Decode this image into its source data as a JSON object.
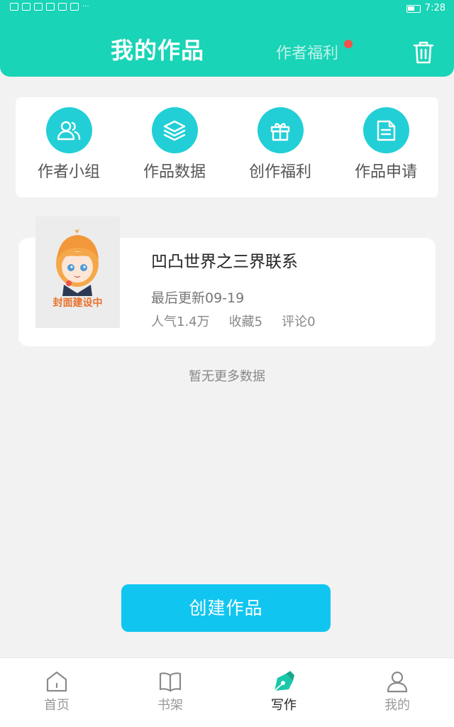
{
  "status_bar": {
    "time": "7:28",
    "overflow": "···"
  },
  "header": {
    "title": "我的作品",
    "welfare_link": "作者福利",
    "trash_icon": "trash-icon"
  },
  "quick_actions": [
    {
      "label": "作者小组",
      "icon": "group-icon"
    },
    {
      "label": "作品数据",
      "icon": "layers-icon"
    },
    {
      "label": "创作福利",
      "icon": "gift-icon"
    },
    {
      "label": "作品申请",
      "icon": "document-icon"
    }
  ],
  "work": {
    "cover_text": "封面建设中",
    "title": "凹凸世界之三界联系",
    "updated": "最后更新09-19",
    "popularity": "人气1.4万",
    "favorites": "收藏5",
    "comments": "评论0"
  },
  "list_footer": "暂无更多数据",
  "create_button": "创建作品",
  "bottom_nav": [
    {
      "label": "首页",
      "icon": "home-icon",
      "active": false
    },
    {
      "label": "书架",
      "icon": "book-icon",
      "active": false
    },
    {
      "label": "写作",
      "icon": "write-icon",
      "active": true
    },
    {
      "label": "我的",
      "icon": "user-icon",
      "active": false
    }
  ],
  "colors": {
    "header": "#19d4b6",
    "accent_circle": "#22cfd6",
    "create_button": "#10c6f0",
    "badge_dot": "#f0524a"
  }
}
